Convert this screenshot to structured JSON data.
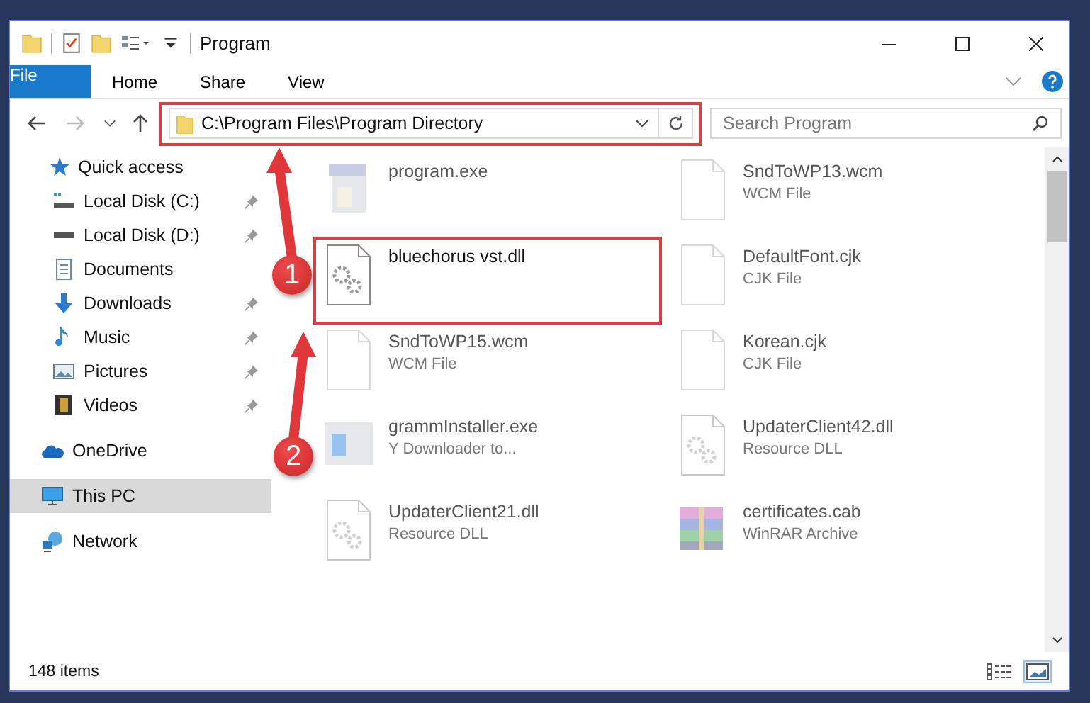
{
  "window": {
    "title": "Program"
  },
  "ribbon_tabs": [
    {
      "label": "File",
      "kind": "file"
    },
    {
      "label": "Home",
      "kind": "tab"
    },
    {
      "label": "Share",
      "kind": "tab"
    },
    {
      "label": "View",
      "kind": "tab"
    }
  ],
  "address_bar": {
    "path": "C:\\Program Files\\Program Directory"
  },
  "search": {
    "placeholder": "Search Program"
  },
  "sidebar": {
    "items": [
      {
        "label": "Quick access",
        "kind": "star",
        "pinned": false,
        "selected": false
      },
      {
        "label": "Local Disk (C:)",
        "kind": "drive-c",
        "pinned": true,
        "selected": false
      },
      {
        "label": "Local Disk (D:)",
        "kind": "drive",
        "pinned": true,
        "selected": false
      },
      {
        "label": "Documents",
        "kind": "documents",
        "pinned": false,
        "selected": false
      },
      {
        "label": "Downloads",
        "kind": "downloads",
        "pinned": true,
        "selected": false
      },
      {
        "label": "Music",
        "kind": "music",
        "pinned": true,
        "selected": false
      },
      {
        "label": "Pictures",
        "kind": "pictures",
        "pinned": true,
        "selected": false
      },
      {
        "label": "Videos",
        "kind": "videos",
        "pinned": true,
        "selected": false
      },
      {
        "label": "OneDrive",
        "kind": "onedrive",
        "pinned": false,
        "selected": false
      },
      {
        "label": "This PC",
        "kind": "pc",
        "pinned": false,
        "selected": true
      },
      {
        "label": "Network",
        "kind": "network",
        "pinned": false,
        "selected": false
      }
    ]
  },
  "files": [
    {
      "name": "program.exe",
      "kind": "exe",
      "highlighted": false
    },
    {
      "name": "SndToWP13.wcm",
      "type": "WCM File",
      "kind": "blank",
      "highlighted": false
    },
    {
      "name": "bluechorus vst.dll",
      "kind": "dll",
      "highlighted": true
    },
    {
      "name": "DefaultFont.cjk",
      "type": "CJK File",
      "kind": "blank",
      "highlighted": false
    },
    {
      "name": "SndToWP15.wcm",
      "type": "WCM File",
      "kind": "blank",
      "highlighted": false
    },
    {
      "name": "Korean.cjk",
      "type": "CJK File",
      "kind": "blank",
      "highlighted": false
    },
    {
      "name": "grammInstaller.exe",
      "type": "Y Downloader to...",
      "kind": "installer",
      "highlighted": false
    },
    {
      "name": "UpdaterClient42.dll",
      "type": "Resource DLL",
      "kind": "dll",
      "highlighted": false
    },
    {
      "name": "UpdaterClient21.dll",
      "type": "Resource DLL",
      "kind": "dll",
      "highlighted": false
    },
    {
      "name": "certificates.cab",
      "type": "WinRAR Archive",
      "kind": "archive",
      "highlighted": false
    }
  ],
  "status_bar": {
    "count": "148 items",
    "views": [
      {
        "kind": "details",
        "selected": false
      },
      {
        "kind": "large-icons",
        "selected": true
      }
    ]
  },
  "annotations": [
    {
      "label": "1"
    },
    {
      "label": "2"
    }
  ]
}
